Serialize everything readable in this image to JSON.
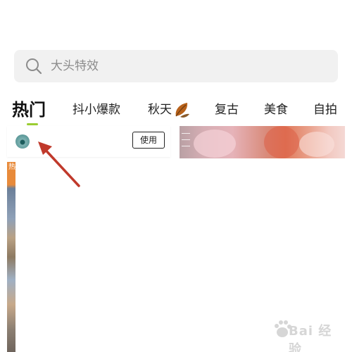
{
  "search": {
    "placeholder": "大头特效",
    "icon": "search-icon"
  },
  "tabs": [
    {
      "label": "热门",
      "active": true
    },
    {
      "label": "抖小爆款",
      "active": false
    },
    {
      "label": "秋天",
      "active": false,
      "icon": "autumn-leaf-icon"
    },
    {
      "label": "复古",
      "active": false
    },
    {
      "label": "美食",
      "active": false
    },
    {
      "label": "自拍",
      "active": false
    }
  ],
  "colors": {
    "tab_indicator": "#9acd32",
    "arrow": "#c0392b",
    "search_bg": "#f1f1f1"
  },
  "effect_card": {
    "use_label": "使用",
    "avatar_icon": "effect-avatar"
  },
  "watermark": {
    "text": "Bai 经验"
  }
}
